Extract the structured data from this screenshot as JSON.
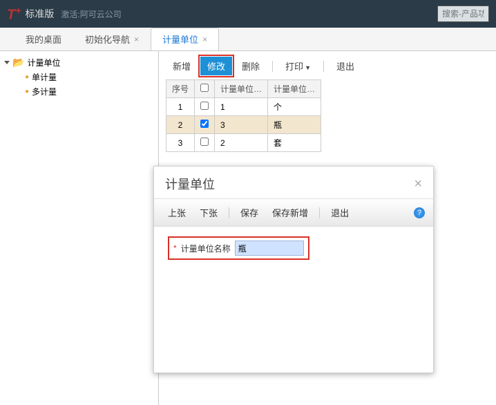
{
  "topbar": {
    "logo_text": "T",
    "logo_plus": "+",
    "edition": "标准版",
    "company": "激活:阿可云公司",
    "search_placeholder": "搜索-产品功能"
  },
  "tabs": [
    {
      "label": "我的桌面",
      "closable": false,
      "active": false
    },
    {
      "label": "初始化导航",
      "closable": true,
      "active": false
    },
    {
      "label": "计量单位",
      "closable": true,
      "active": true
    }
  ],
  "tree": {
    "root": "计量单位",
    "children": [
      "单计量",
      "多计量"
    ]
  },
  "toolbar": {
    "add": "新增",
    "edit": "修改",
    "delete": "删除",
    "print": "打印",
    "exit": "退出"
  },
  "grid": {
    "headers": {
      "seq": "序号",
      "code": "计量单位…",
      "name": "计量单位…"
    },
    "rows": [
      {
        "seq": "1",
        "checked": false,
        "code": "1",
        "name": "个"
      },
      {
        "seq": "2",
        "checked": true,
        "code": "3",
        "name": "瓶"
      },
      {
        "seq": "3",
        "checked": false,
        "code": "2",
        "name": "套"
      }
    ]
  },
  "dialog": {
    "title": "计量单位",
    "toolbar": {
      "prev": "上张",
      "next": "下张",
      "save": "保存",
      "savenew": "保存新增",
      "exit": "退出"
    },
    "field_label": "计量单位名称",
    "field_value": "瓶"
  }
}
